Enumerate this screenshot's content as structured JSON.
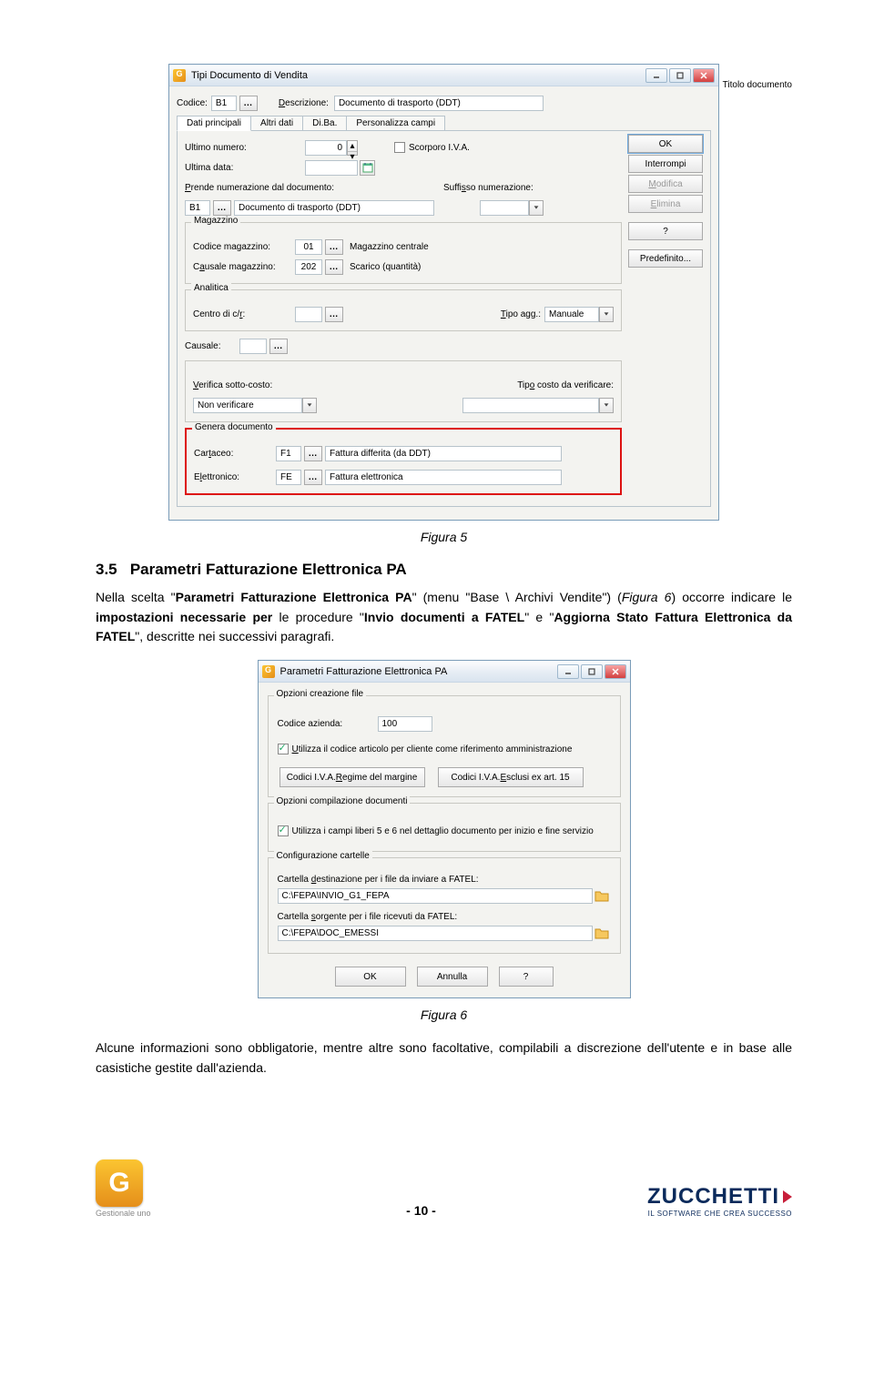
{
  "header_right": "Titolo documento",
  "win1": {
    "title": "Tipi Documento di Vendita",
    "codice_label": "Codice:",
    "codice_value": "B1",
    "descrizione_label": "Descrizione:",
    "descrizione_value": "Documento di trasporto (DDT)",
    "tabs": [
      "Dati principali",
      "Altri dati",
      "Di.Ba.",
      "Personalizza campi"
    ],
    "ultimo_numero_label": "Ultimo numero:",
    "ultimo_numero_value": "0",
    "scorporo_label": "Scorporo I.V.A.",
    "ultima_data_label": "Ultima data:",
    "prende_num_label": "Prende numerazione dal documento:",
    "suffisso_label": "Suffisso numerazione:",
    "prende_num_code": "B1",
    "prende_num_desc": "Documento di trasporto (DDT)",
    "magazzino_legend": "Magazzino",
    "codice_mag_label": "Codice magazzino:",
    "codice_mag_code": "01",
    "codice_mag_desc": "Magazzino centrale",
    "causale_mag_label": "Causale magazzino:",
    "causale_mag_code": "202",
    "causale_mag_desc": "Scarico (quantità)",
    "analitica_legend": "Analitica",
    "centro_label": "Centro di c/r:",
    "tipo_agg_label": "Tipo agg.:",
    "tipo_agg_value": "Manuale",
    "causale_label": "Causale:",
    "verifica_label": "Verifica sotto-costo:",
    "verifica_value": "Non verificare",
    "tipo_costo_label": "Tipo costo da verificare:",
    "genera_legend": "Genera documento",
    "cartaceo_label": "Cartaceo:",
    "cartaceo_code": "F1",
    "cartaceo_desc": "Fattura differita (da DDT)",
    "elettronico_label": "Elettronico:",
    "elettronico_code": "FE",
    "elettronico_desc": "Fattura elettronica",
    "actions": {
      "ok": "OK",
      "interrompi": "Interrompi",
      "modifica": "Modifica",
      "elimina": "Elimina",
      "help": "?",
      "predefinito": "Predefinito..."
    }
  },
  "fig5_caption": "Figura 5",
  "section_heading_num": "3.5",
  "section_heading_text": "Parametri Fatturazione Elettronica PA",
  "para1_a": "Nella scelta \"",
  "para1_b": "Parametri Fatturazione Elettronica PA",
  "para1_c": "\" (menu \"Base \\ Archivi Vendite\") (",
  "para1_d": "Figura 6",
  "para1_e": ") occorre indicare le ",
  "para1_f": "impostazioni necessarie per",
  "para1_g": " le procedure \"",
  "para1_h": "Invio documenti a FATEL",
  "para1_i": "\" e \"",
  "para1_j": "Aggiorna Stato Fattura Elettronica da FATEL",
  "para1_k": "\", descritte nei successivi paragrafi.",
  "win2": {
    "title": "Parametri Fatturazione Elettronica PA",
    "opzioni_creazione_legend": "Opzioni creazione file",
    "codice_azienda_label": "Codice azienda:",
    "codice_azienda_value": "100",
    "utilizza_codice_label": "Utilizza il codice articolo per cliente come riferimento amministrazione",
    "btn_regime": "Codici I.V.A. Regime del margine",
    "btn_esclusi": "Codici I.V.A. Esclusi ex art. 15",
    "opzioni_compilazione_legend": "Opzioni compilazione documenti",
    "utilizza_campi_label": "Utilizza i campi liberi 5 e 6 nel dettaglio documento per inizio e fine servizio",
    "config_cartelle_legend": "Configurazione cartelle",
    "cartella_dest_label": "Cartella destinazione per i file da inviare a FATEL:",
    "cartella_dest_value": "C:\\FEPA\\INVIO_G1_FEPA",
    "cartella_sorg_label": "Cartella sorgente per i file ricevuti da FATEL:",
    "cartella_sorg_value": "C:\\FEPA\\DOC_EMESSI",
    "ok": "OK",
    "annulla": "Annulla",
    "help": "?"
  },
  "fig6_caption": "Figura 6",
  "para2": "Alcune informazioni sono obbligatorie, mentre altre sono facoltative, compilabili a discrezione dell'utente e in base alle casistiche gestite dall'azienda.",
  "footer": {
    "pagenum": "- 10 -",
    "g1_text": "Gestionale uno",
    "zucchetti": "ZUCCHETTI",
    "zucchetti_tag": "IL SOFTWARE CHE CREA SUCCESSO"
  }
}
